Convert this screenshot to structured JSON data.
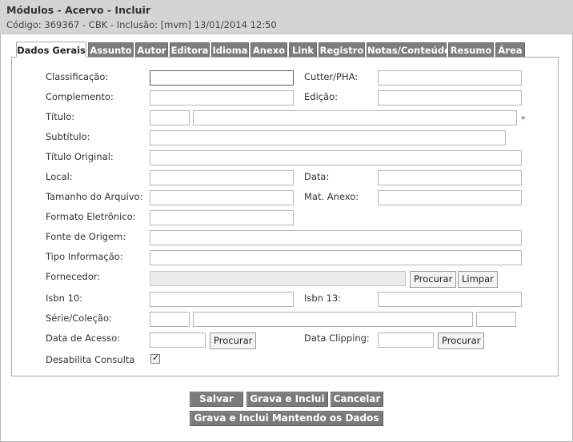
{
  "header": {
    "title": "Módulos - Acervo - Incluir",
    "subtitle": "Código: 369367 - CBK - Inclusão: [mvm] 13/01/2014 12:50"
  },
  "tabs": [
    {
      "label": "Dados Gerais",
      "active": true
    },
    {
      "label": "Assunto"
    },
    {
      "label": "Autor"
    },
    {
      "label": "Editora"
    },
    {
      "label": "Idioma"
    },
    {
      "label": "Anexo"
    },
    {
      "label": "Link"
    },
    {
      "label": "Registro"
    },
    {
      "label": "Notas/Conteúdo"
    },
    {
      "label": "Resumo"
    },
    {
      "label": "Área"
    }
  ],
  "form": {
    "classificacao": "Classificação:",
    "cutter": "Cutter/PHA:",
    "complemento": "Complemento:",
    "edicao": "Edição:",
    "titulo": "Título:",
    "required_mark": "*",
    "subtitulo": "Subtítulo:",
    "titulo_original": "Título Original:",
    "local": "Local:",
    "data": "Data:",
    "tamanho": "Tamanho do Arquivo:",
    "mat_anexo": "Mat. Anexo:",
    "formato": "Formato Eletrônico:",
    "fonte": "Fonte de Origem:",
    "tipo": "Tipo Informação:",
    "fornecedor": "Fornecedor:",
    "isbn10": "Isbn 10:",
    "isbn13": "Isbn 13:",
    "serie": "Série/Coleção:",
    "data_acesso": "Data de Acesso:",
    "data_clipping": "Data Clipping:",
    "desabilita": "Desabilita Consulta",
    "desabilita_checked": true,
    "procurar": "Procurar",
    "limpar": "Limpar",
    "check_glyph": "✓"
  },
  "actions": {
    "salvar": "Salvar",
    "grava_inclui": "Grava e Inclui",
    "cancelar": "Cancelar",
    "grava_mantendo": "Grava e Inclui Mantendo os Dados"
  }
}
